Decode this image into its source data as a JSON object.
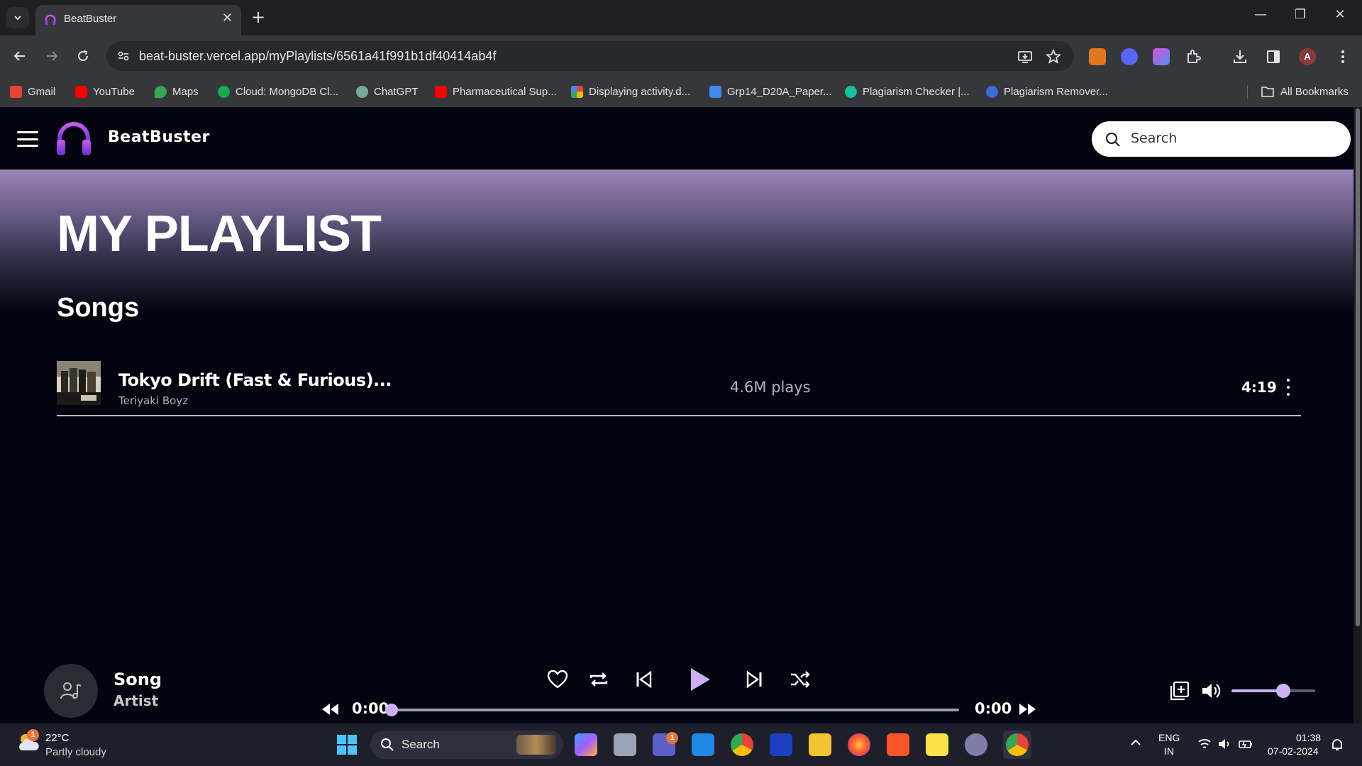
{
  "browser": {
    "tab": {
      "title": "BeatBuster",
      "close": "✕"
    },
    "new_tab": "+",
    "window": {
      "minimize": "—",
      "restore": "❐",
      "close": "✕"
    },
    "address": {
      "url": "beat-buster.vercel.app/myPlaylists/6561a41f991b1df40414ab4f"
    },
    "bookmarks": [
      {
        "label": "Gmail",
        "color": "#ea4335"
      },
      {
        "label": "YouTube",
        "color": "#ff0000"
      },
      {
        "label": "Maps",
        "color": "#34a853"
      },
      {
        "label": "Cloud: MongoDB Cl...",
        "color": "#13aa52"
      },
      {
        "label": "ChatGPT",
        "color": "#74aa9c"
      },
      {
        "label": "Pharmaceutical Sup...",
        "color": "#ff0000"
      },
      {
        "label": "Displaying activity.d...",
        "color": "#fbbc05"
      },
      {
        "label": "Grp14_D20A_Paper...",
        "color": "#4285f4"
      },
      {
        "label": "Plagiarism Checker |...",
        "color": "#15c39a"
      },
      {
        "label": "Plagiarism Remover...",
        "color": "#3b6fd8"
      }
    ],
    "all_bookmarks": "All Bookmarks",
    "profile_initial": "A"
  },
  "app": {
    "brand": "BeatBuster",
    "search_placeholder": "Search",
    "page_title": "MY PLAYLIST",
    "section_title": "Songs",
    "accent_color": "#c9b0f5",
    "songs": [
      {
        "title": "Tokyo Drift (Fast & Furious)...",
        "artist": "Teriyaki Boyz",
        "plays": "4.6M plays",
        "duration": "4:19"
      }
    ]
  },
  "player": {
    "song": "Song",
    "artist": "Artist",
    "current_time": "0:00",
    "total_time": "0:00",
    "progress": 0,
    "volume": 0.62
  },
  "taskbar": {
    "weather": {
      "temp": "22°C",
      "desc": "Partly cloudy",
      "badge": "1"
    },
    "search_placeholder": "Search",
    "teams_badge": "1",
    "language": {
      "lang": "ENG",
      "region": "IN"
    },
    "clock": {
      "time": "01:38",
      "date": "07-02-2024"
    }
  }
}
